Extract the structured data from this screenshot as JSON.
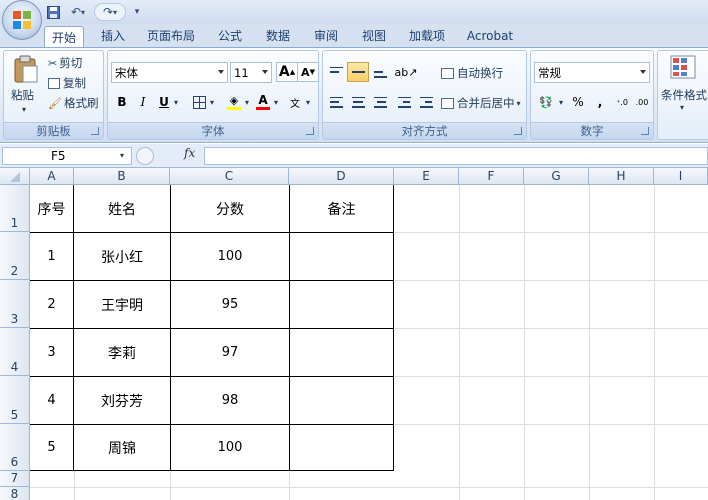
{
  "ribbon_tabs": [
    "开始",
    "插入",
    "页面布局",
    "公式",
    "数据",
    "审阅",
    "视图",
    "加载项",
    "Acrobat"
  ],
  "clipboard": {
    "paste": "粘贴",
    "cut": "剪切",
    "copy": "复制",
    "format_painter": "格式刷",
    "group": "剪贴板"
  },
  "font": {
    "name": "宋体",
    "size": "11",
    "bold": "B",
    "italic": "I",
    "underline": "U",
    "grow": "A",
    "shrink": "A",
    "fill_color": "#ffff00",
    "font_color": "#ff0000",
    "group": "字体"
  },
  "alignment": {
    "wrap_text": "自动换行",
    "merge_center": "合并后居中",
    "group": "对齐方式"
  },
  "number": {
    "format": "常规",
    "percent": "%",
    "comma": ",",
    "group": "数字"
  },
  "styles": {
    "conditional": "条件格式"
  },
  "name_box": "F5",
  "fx": "fx",
  "columns": [
    "A",
    "B",
    "C",
    "D",
    "E",
    "F",
    "G",
    "H",
    "I"
  ],
  "rows": [
    "1",
    "2",
    "3",
    "4",
    "5",
    "6",
    "7",
    "8"
  ],
  "table": {
    "headers": [
      "序号",
      "姓名",
      "分数",
      "备注"
    ],
    "rows": [
      [
        "1",
        "张小红",
        "100",
        ""
      ],
      [
        "2",
        "王宇明",
        "95",
        ""
      ],
      [
        "3",
        "李莉",
        "97",
        ""
      ],
      [
        "4",
        "刘芬芳",
        "98",
        ""
      ],
      [
        "5",
        "周锦",
        "100",
        ""
      ]
    ]
  }
}
